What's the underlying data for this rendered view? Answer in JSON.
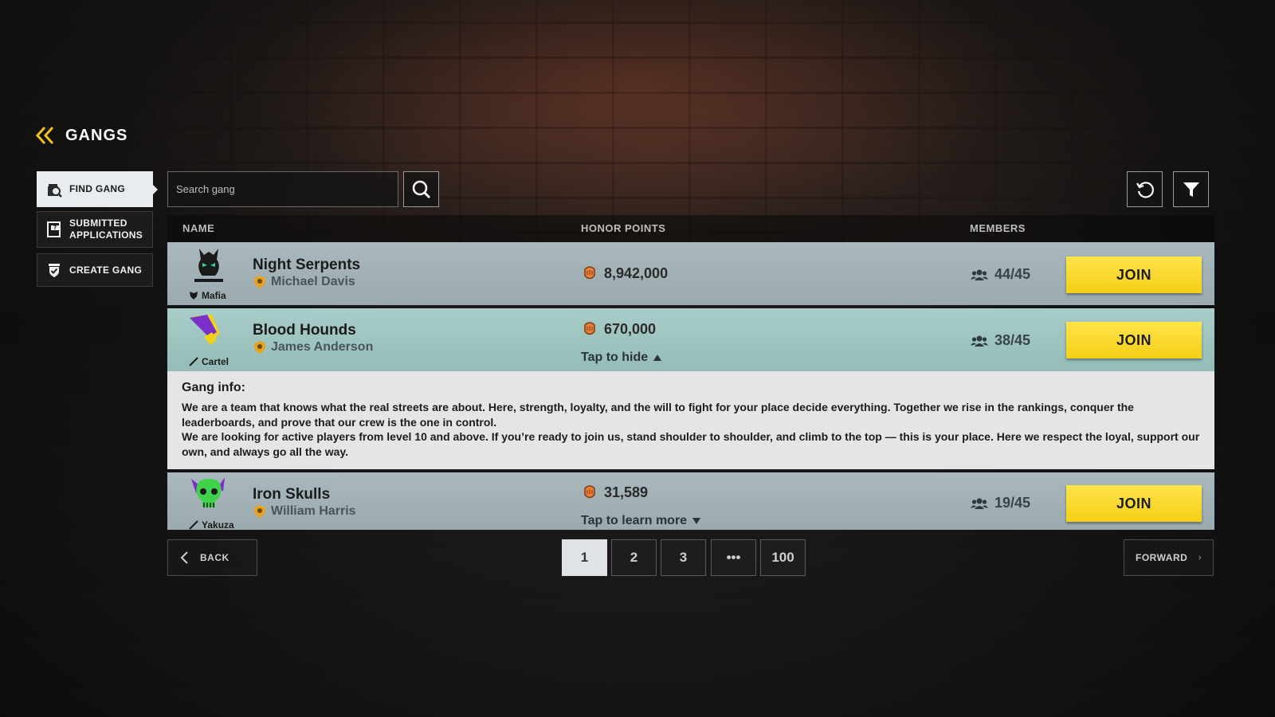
{
  "header": {
    "title": "GANGS"
  },
  "sidebar": {
    "items": [
      {
        "label": "FIND GANG",
        "icon": "find-gang-icon",
        "active": true
      },
      {
        "label": "SUBMITTED APPLICATIONS",
        "icon": "applications-icon",
        "active": false
      },
      {
        "label": "CREATE GANG",
        "icon": "create-gang-icon",
        "active": false
      }
    ]
  },
  "search": {
    "placeholder": "Search gang",
    "value": ""
  },
  "table": {
    "columns": {
      "name": "NAME",
      "honor": "HONOR POINTS",
      "members": "MEMBERS"
    },
    "rows": [
      {
        "name": "Night Serpents",
        "leader": "Michael Davis",
        "type": "Mafia",
        "honor": "8,942,000",
        "members": "44/45",
        "join": "JOIN",
        "toggle": ""
      },
      {
        "name": "Blood Hounds",
        "leader": "James Anderson",
        "type": "Cartel",
        "honor": "670,000",
        "members": "38/45",
        "join": "JOIN",
        "toggle": "Tap to hide"
      },
      {
        "name": "Iron Skulls",
        "leader": "William Harris",
        "type": "Yakuza",
        "honor": "31,589",
        "members": "19/45",
        "join": "JOIN",
        "toggle": "Tap to learn more"
      }
    ],
    "info": {
      "title": "Gang info:",
      "text1": "We are a team that knows what the real streets are about. Here, strength, loyalty, and the will to fight for your place decide everything. Together we rise in the rankings, conquer the leaderboards, and prove that our crew is the one in control.",
      "text2": "We are looking for active players from level 10 and above. If you’re ready to join us, stand shoulder to shoulder, and climb to the top — this is your place. Here we respect the loyal, support our own, and always go all the way."
    }
  },
  "pagination": {
    "back": "BACK",
    "forward": "FORWARD",
    "pages": [
      "1",
      "2",
      "3",
      "•••",
      "100"
    ],
    "current": "1"
  },
  "colors": {
    "accent": "#f7d21c",
    "row": "#a3b3b7",
    "row_expanded": "#a0c6c1",
    "info_bg": "#e3e5e6"
  }
}
